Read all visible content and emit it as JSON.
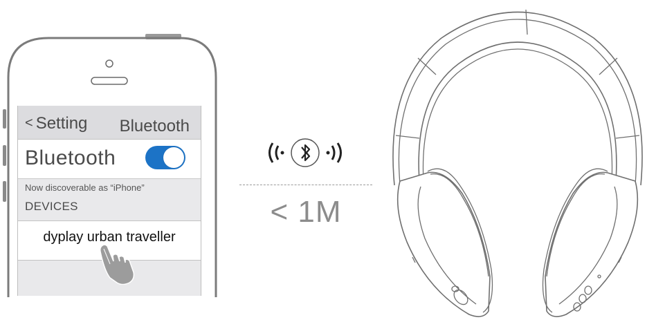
{
  "phone": {
    "nav": {
      "back_label": "Setting",
      "back_chevron": "<",
      "title": "Bluetooth"
    },
    "bluetooth_row": {
      "label": "Bluetooth",
      "toggle_on": true,
      "toggle_color": "#1c73c6"
    },
    "discoverable_text": "Now discoverable as “iPhone”",
    "devices_header": "DEVICES",
    "device_item": "dyplay urban traveller",
    "icons": [
      "hand-pointer-icon",
      "speaker-slot-icon",
      "camera-dot-icon"
    ]
  },
  "connection": {
    "icon": "bluetooth-icon",
    "distance": "< 1M"
  },
  "headphones": {
    "icon": "headphones-illustration"
  }
}
